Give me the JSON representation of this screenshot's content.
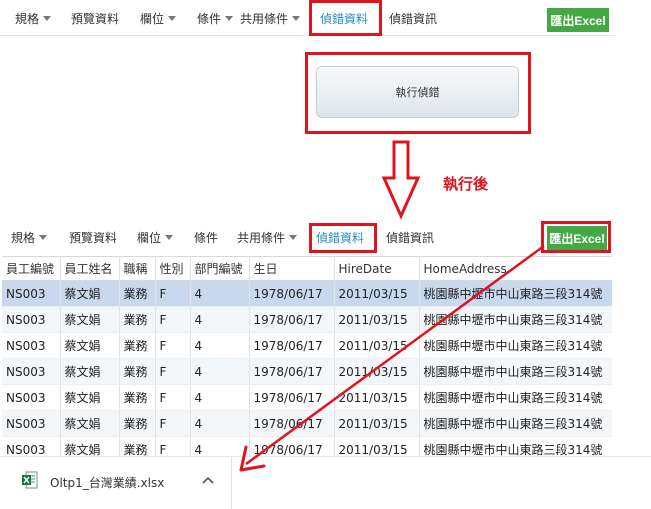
{
  "toolbar_top": {
    "items": [
      {
        "label": "規格",
        "dropdown": true
      },
      {
        "label": "預覽資料",
        "dropdown": false
      },
      {
        "label": "欄位",
        "dropdown": true
      },
      {
        "label": "條件",
        "dropdown": true
      },
      {
        "label": "共用條件",
        "dropdown": true
      },
      {
        "label": "偵錯資料",
        "dropdown": false,
        "active": true
      },
      {
        "label": "偵錯資訊",
        "dropdown": false
      }
    ],
    "export_label": "匯出Excel"
  },
  "run_button_label": "執行偵錯",
  "after_label": "執行後",
  "toolbar_bottom": {
    "items": [
      {
        "label": "規格",
        "dropdown": true
      },
      {
        "label": "預覽資料",
        "dropdown": false
      },
      {
        "label": "欄位",
        "dropdown": true
      },
      {
        "label": "條件",
        "dropdown": false
      },
      {
        "label": "共用條件",
        "dropdown": true
      },
      {
        "label": "偵錯資料",
        "dropdown": false,
        "active": true
      },
      {
        "label": "偵錯資訊",
        "dropdown": false
      }
    ],
    "export_label": "匯出Excel"
  },
  "grid": {
    "columns": [
      "員工編號",
      "員工姓名",
      "職稱",
      "性別",
      "部門編號",
      "生日",
      "HireDate",
      "HomeAddress"
    ],
    "rows": [
      [
        "NS003",
        "蔡文娟",
        "業務",
        "F",
        "4",
        "1978/06/17",
        "2011/03/15",
        "桃園縣中壢市中山東路三段314號"
      ],
      [
        "NS003",
        "蔡文娟",
        "業務",
        "F",
        "4",
        "1978/06/17",
        "2011/03/15",
        "桃園縣中壢市中山東路三段314號"
      ],
      [
        "NS003",
        "蔡文娟",
        "業務",
        "F",
        "4",
        "1978/06/17",
        "2011/03/15",
        "桃園縣中壢市中山東路三段314號"
      ],
      [
        "NS003",
        "蔡文娟",
        "業務",
        "F",
        "4",
        "1978/06/17",
        "2011/03/15",
        "桃園縣中壢市中山東路三段314號"
      ],
      [
        "NS003",
        "蔡文娟",
        "業務",
        "F",
        "4",
        "1978/06/17",
        "2011/03/15",
        "桃園縣中壢市中山東路三段314號"
      ],
      [
        "NS003",
        "蔡文娟",
        "業務",
        "F",
        "4",
        "1978/06/17",
        "2011/03/15",
        "桃園縣中壢市中山東路三段314號"
      ],
      [
        "NS003",
        "蔡文娟",
        "業務",
        "F",
        "4",
        "1978/06/17",
        "2011/03/15",
        "桃園縣中壢市中山東路三段314號"
      ]
    ],
    "selected_row": 0
  },
  "download": {
    "filename": "Oltp1_台灣業績.xlsx"
  },
  "colors": {
    "accent_red": "#e0141e",
    "excel_green": "#45a845",
    "active_tab": "#2a8bc7",
    "selected_row": "#c8d8ef"
  }
}
